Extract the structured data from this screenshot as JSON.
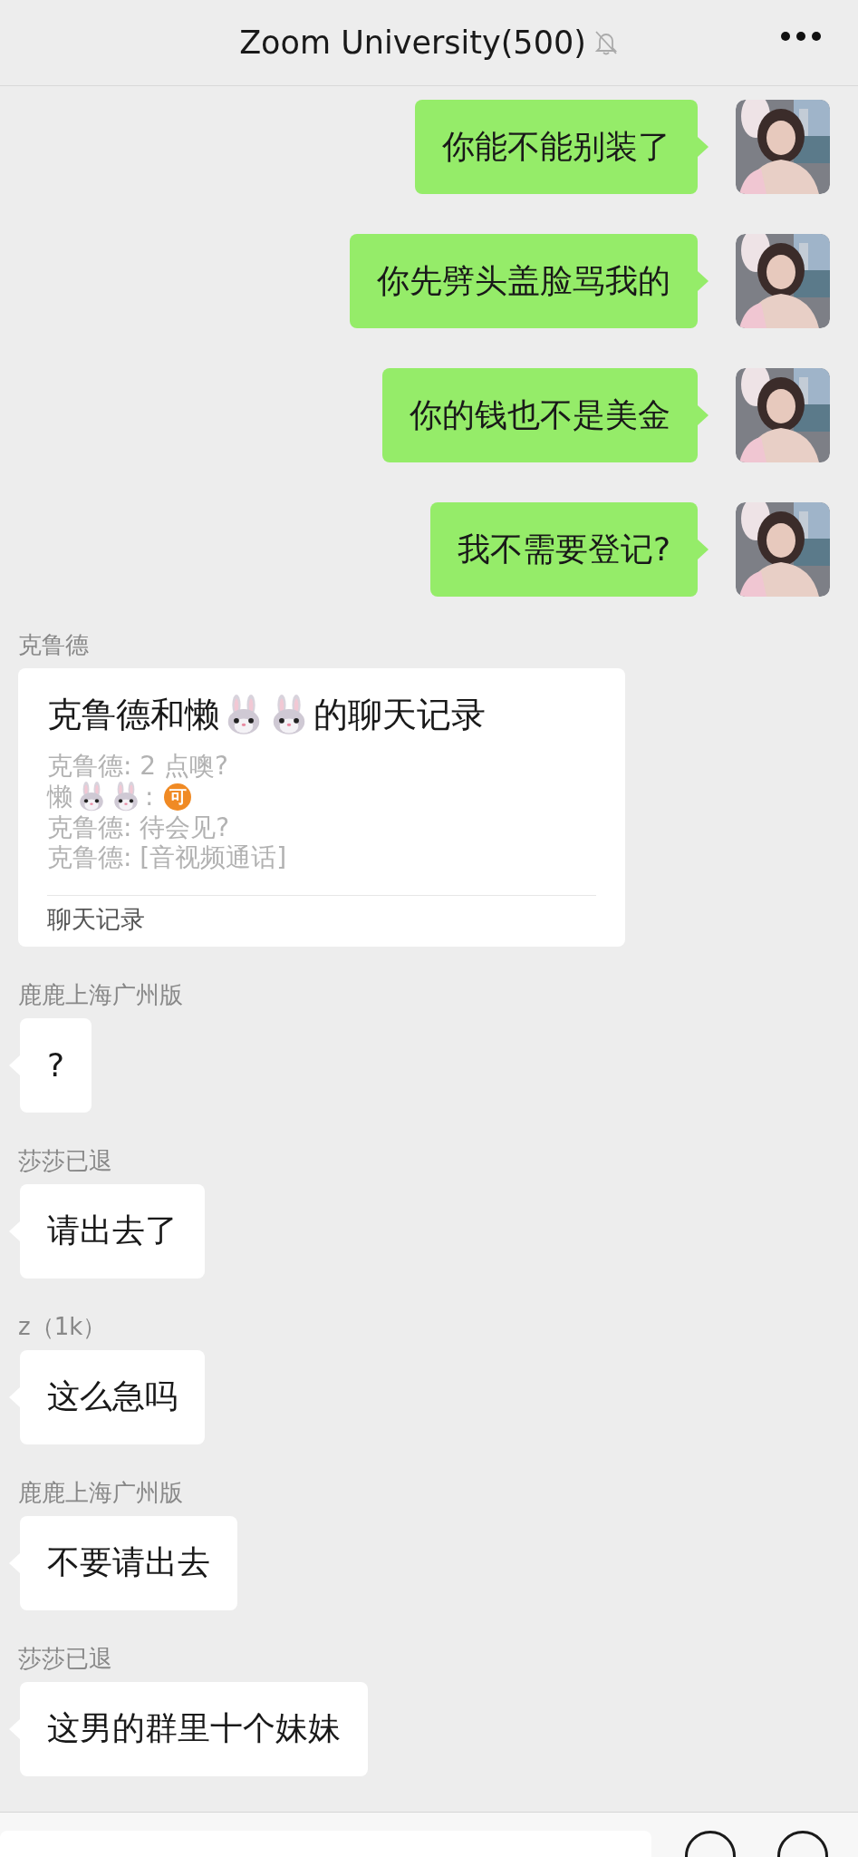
{
  "header": {
    "title": "Zoom University(500)",
    "muted": true
  },
  "messages": [
    {
      "kind": "outgoing",
      "text": "你能不能别装了"
    },
    {
      "kind": "outgoing",
      "text": "你先劈头盖脸骂我的"
    },
    {
      "kind": "outgoing",
      "text": "你的钱也不是美金"
    },
    {
      "kind": "outgoing",
      "text": "我不需要登记?"
    },
    {
      "kind": "chat_record",
      "sender": "克鲁德",
      "title": [
        {
          "kind": "text",
          "text": "克鲁德和懒"
        },
        {
          "kind": "emoji"
        },
        {
          "kind": "emoji"
        },
        {
          "kind": "text",
          "text": "的聊天记录"
        }
      ],
      "lines": [
        [
          {
            "kind": "text",
            "text": "克鲁德: 2 点噢?"
          }
        ],
        [
          {
            "kind": "text",
            "text": "懒"
          },
          {
            "kind": "emoji"
          },
          {
            "kind": "emoji"
          },
          {
            "kind": "text",
            "text": ":"
          },
          {
            "kind": "badge",
            "text": "可"
          }
        ],
        [
          {
            "kind": "text",
            "text": "克鲁德: 待会见?"
          }
        ],
        [
          {
            "kind": "text",
            "text": "克鲁德: [音视频通话]"
          }
        ]
      ],
      "footer": "聊天记录"
    },
    {
      "kind": "incoming",
      "sender": "鹿鹿上海广州版",
      "text": "?"
    },
    {
      "kind": "incoming",
      "sender": "莎莎已退",
      "text": "请出去了"
    },
    {
      "kind": "incoming",
      "sender": "z（1k）",
      "text": "这么急吗"
    },
    {
      "kind": "incoming",
      "sender": "鹿鹿上海广州版",
      "text": "不要请出去"
    },
    {
      "kind": "incoming",
      "sender": "莎莎已退",
      "text": "这男的群里十个妹妹"
    }
  ]
}
